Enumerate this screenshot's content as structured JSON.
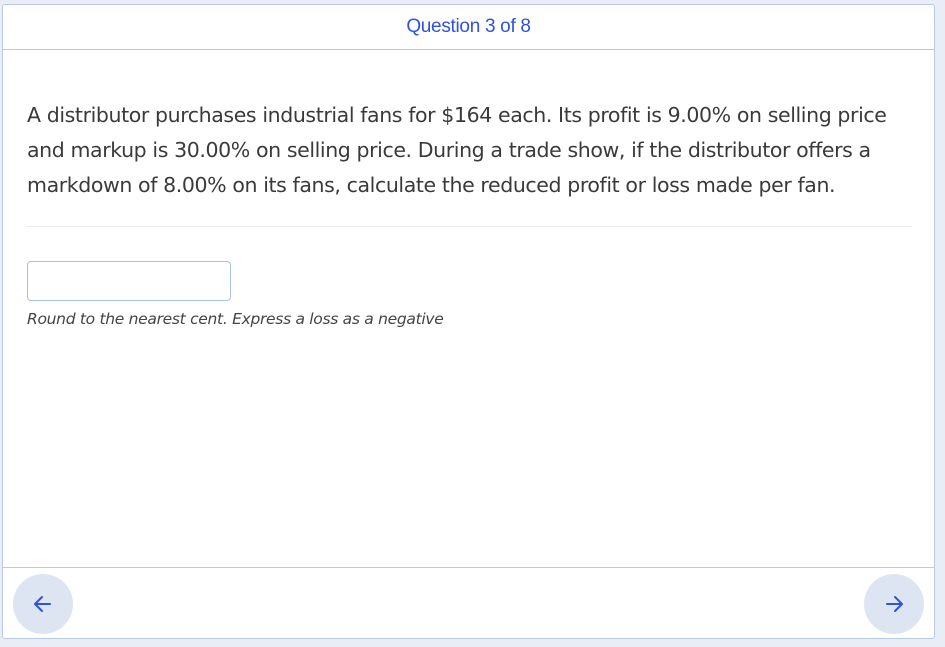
{
  "header": {
    "title": "Question 3 of 8"
  },
  "question": {
    "text": "A distributor purchases industrial fans for $164 each. Its profit is 9.00% on selling price and markup is 30.00% on selling price. During a trade show, if the distributor offers a markdown of 8.00% on its fans, calculate the reduced profit or loss made per fan."
  },
  "answer": {
    "value": "",
    "hint": "Round to the nearest cent. Express a loss as a negative"
  },
  "navigation": {
    "prev_icon": "arrow-left-icon",
    "next_icon": "arrow-right-icon"
  },
  "colors": {
    "accent": "#2f52e0",
    "border": "#b9cbe3",
    "nav_button_bg": "#dde5f2"
  }
}
